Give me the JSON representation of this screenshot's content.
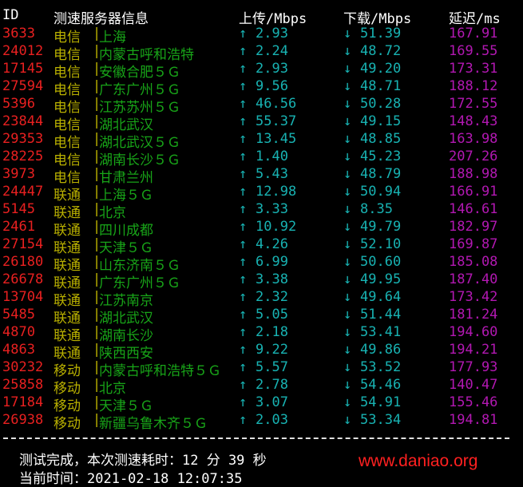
{
  "header": {
    "id": "ID",
    "server": "测速服务器信息",
    "upload": "上传/Mbps",
    "download": "下载/Mbps",
    "latency": "延迟/ms"
  },
  "colors": {
    "header": "#ffffff",
    "id": "#e82020",
    "isp": "#b9b000",
    "city": "#18a418",
    "speed": "#18b2b2",
    "latency": "#b218b2",
    "watermark": "#ff2020"
  },
  "arrows": {
    "up": "↑",
    "down": "↓"
  },
  "separator": "|",
  "rows": [
    {
      "id": "3633",
      "isp": "电信",
      "city": "上海",
      "up": "2.93",
      "down": "51.39",
      "lat": "167.91"
    },
    {
      "id": "24012",
      "isp": "电信",
      "city": "内蒙古呼和浩特",
      "up": "2.24",
      "down": "48.72",
      "lat": "169.55"
    },
    {
      "id": "17145",
      "isp": "电信",
      "city": "安徽合肥５Ｇ",
      "up": "2.93",
      "down": "49.20",
      "lat": "173.31"
    },
    {
      "id": "27594",
      "isp": "电信",
      "city": "广东广州５Ｇ",
      "up": "9.56",
      "down": "48.71",
      "lat": "188.12"
    },
    {
      "id": "5396",
      "isp": "电信",
      "city": "江苏苏州５Ｇ",
      "up": "46.56",
      "down": "50.28",
      "lat": "172.55"
    },
    {
      "id": "23844",
      "isp": "电信",
      "city": "湖北武汉",
      "up": "55.37",
      "down": "49.15",
      "lat": "148.43"
    },
    {
      "id": "29353",
      "isp": "电信",
      "city": "湖北武汉５Ｇ",
      "up": "13.45",
      "down": "48.85",
      "lat": "163.98"
    },
    {
      "id": "28225",
      "isp": "电信",
      "city": "湖南长沙５Ｇ",
      "up": "1.40",
      "down": "45.23",
      "lat": "207.26"
    },
    {
      "id": "3973",
      "isp": "电信",
      "city": "甘肃兰州",
      "up": "5.43",
      "down": "48.79",
      "lat": "188.98"
    },
    {
      "id": "24447",
      "isp": "联通",
      "city": "上海５Ｇ",
      "up": "12.98",
      "down": "50.94",
      "lat": "166.91"
    },
    {
      "id": "5145",
      "isp": "联通",
      "city": "北京",
      "up": "3.33",
      "down": "8.35",
      "lat": "146.61"
    },
    {
      "id": "2461",
      "isp": "联通",
      "city": "四川成都",
      "up": "10.92",
      "down": "49.79",
      "lat": "182.97"
    },
    {
      "id": "27154",
      "isp": "联通",
      "city": "天津５Ｇ",
      "up": "4.26",
      "down": "52.10",
      "lat": "169.87"
    },
    {
      "id": "26180",
      "isp": "联通",
      "city": "山东济南５Ｇ",
      "up": "6.99",
      "down": "50.60",
      "lat": "185.08"
    },
    {
      "id": "26678",
      "isp": "联通",
      "city": "广东广州５Ｇ",
      "up": "3.38",
      "down": "49.95",
      "lat": "187.40"
    },
    {
      "id": "13704",
      "isp": "联通",
      "city": "江苏南京",
      "up": "2.32",
      "down": "49.64",
      "lat": "173.42"
    },
    {
      "id": "5485",
      "isp": "联通",
      "city": "湖北武汉",
      "up": "5.05",
      "down": "51.44",
      "lat": "181.24"
    },
    {
      "id": "4870",
      "isp": "联通",
      "city": "湖南长沙",
      "up": "2.18",
      "down": "53.41",
      "lat": "194.60"
    },
    {
      "id": "4863",
      "isp": "联通",
      "city": "陕西西安",
      "up": "9.22",
      "down": "49.86",
      "lat": "194.21"
    },
    {
      "id": "30232",
      "isp": "移动",
      "city": "内蒙古呼和浩特５Ｇ",
      "up": "5.57",
      "down": "53.52",
      "lat": "177.93"
    },
    {
      "id": "25858",
      "isp": "移动",
      "city": "北京",
      "up": "2.78",
      "down": "54.46",
      "lat": "140.47"
    },
    {
      "id": "17184",
      "isp": "移动",
      "city": "天津５Ｇ",
      "up": "3.07",
      "down": "54.91",
      "lat": "155.46"
    },
    {
      "id": "26938",
      "isp": "移动",
      "city": "新疆乌鲁木齐５Ｇ",
      "up": "2.03",
      "down": "53.34",
      "lat": "194.81"
    }
  ],
  "footer": {
    "complete": "测试完成，本次测速耗时：12 分 39 秒",
    "time": "当前时间：2021-02-18 12:07:35"
  },
  "watermark": "www.daniao.org"
}
